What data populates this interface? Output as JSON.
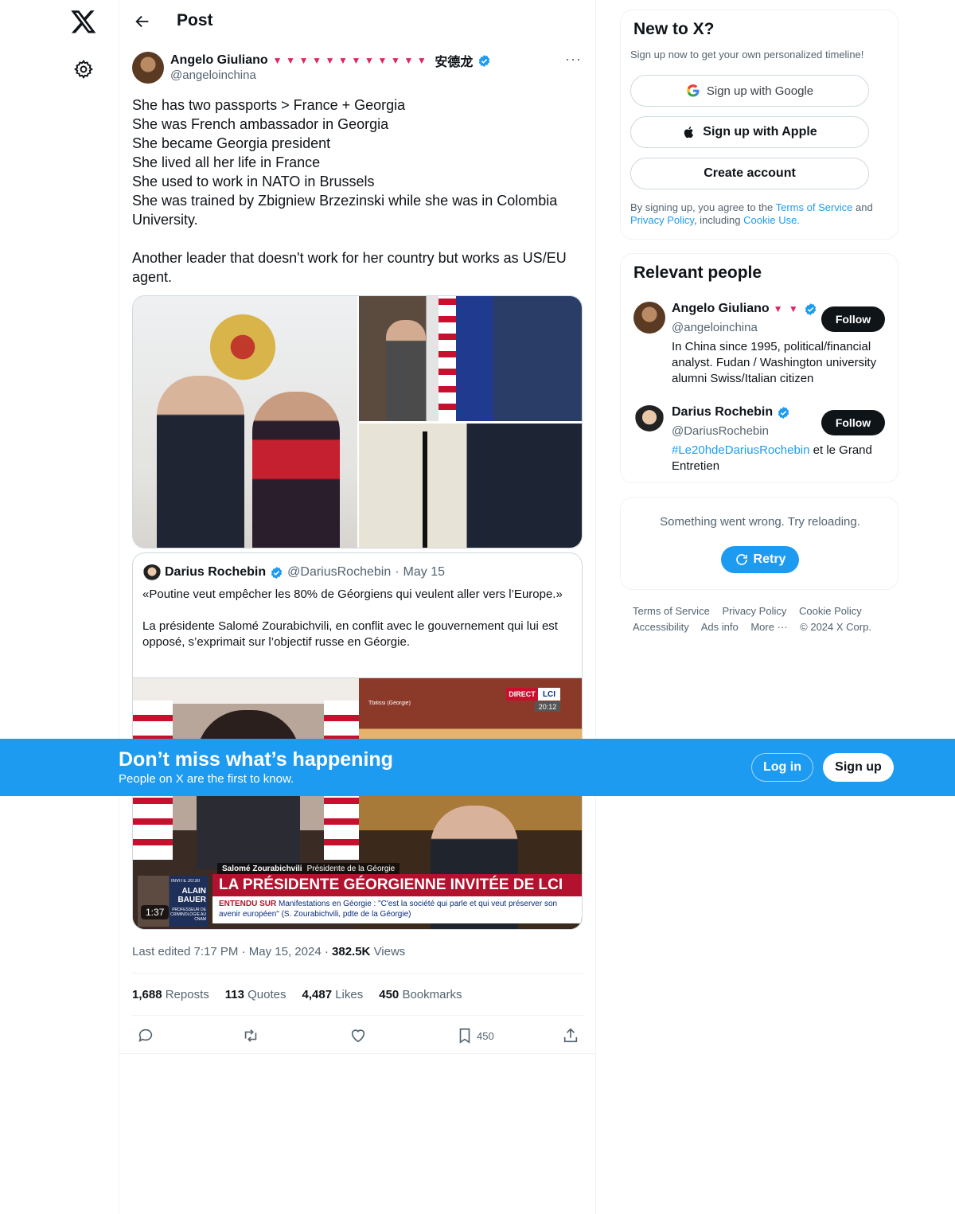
{
  "header": {
    "title": "Post"
  },
  "post": {
    "author_name": "Angelo Giuliano",
    "author_hearts": "▼▼▼▼▼▼▼▼▼▼▼▼",
    "author_suffix": "安德龙",
    "author_handle": "@angeloinchina",
    "more": "···",
    "text": "She has two passports > France + Georgia\nShe was French ambassador in Georgia\nShe became Georgia president\nShe lived all her life in France\nShe used to work in NATO in Brussels\nShe was trained by Zbigniew Brzezinski while she was in Colombia University.\n\nAnother leader that doesn't work for her country but works as US/EU agent.",
    "meta_edited": "Last edited 7:17 PM",
    "meta_date": "May 15, 2024",
    "meta_views_count": "382.5K",
    "meta_views_label": "Views",
    "stats": {
      "reposts_count": "1,688",
      "reposts_label": "Reposts",
      "quotes_count": "113",
      "quotes_label": "Quotes",
      "likes_count": "4,487",
      "likes_label": "Likes",
      "bookmarks_count": "450",
      "bookmarks_label": "Bookmarks"
    },
    "bookmark_action_count": "450"
  },
  "quote": {
    "name": "Darius Rochebin",
    "handle": "@DariusRochebin",
    "date": "May 15",
    "text": "«Poutine veut empêcher les 80% de Géorgiens qui veulent aller vers l’Europe.»\n\nLa présidente Salomé Zourabichvili, en conflit avec le gouvernement qui lui est opposé, s’exprimait sur l’objectif russe en Géorgie.",
    "video_duration": "1:37",
    "lci_direct": "DIRECT",
    "lci_logo": "LCI",
    "lci_clock": "20:12",
    "lci_location": "Tbilissi (Géorgie)",
    "lci_caption_name": "Salomé Zourabichvili",
    "lci_caption_role": "Présidente de la Géorgie",
    "lci_headline": "LA PRÉSIDENTE GÉORGIENNE INVITÉE DE LCI",
    "lci_ticker_prefix": "ENTENDU SUR",
    "lci_ticker": "Manifestations en Géorgie : \"C'est la société qui parle et qui veut préserver son avenir européen\" (S. Zourabichvili, pdte de la Géorgie)",
    "lci_guest_tag": "INVITÉ",
    "lci_guest_time": "20:30",
    "lci_guest_name": "ALAIN BAUER",
    "lci_guest_role": "PROFESSEUR DE CRIMINOLOGIE AU CNAM"
  },
  "banner": {
    "title": "Don’t miss what’s happening",
    "subtitle": "People on X are the first to know.",
    "login": "Log in",
    "signup": "Sign up"
  },
  "new_to_x": {
    "title": "New to X?",
    "subtitle": "Sign up now to get your own personalized timeline!",
    "google": "Sign up with Google",
    "apple": "Sign up with Apple",
    "create": "Create account",
    "terms_prefix": "By signing up, you agree to the ",
    "terms_link": "Terms of Service",
    "terms_and": " and ",
    "privacy_link": "Privacy Policy",
    "including": ", including ",
    "cookie_link": "Cookie Use."
  },
  "relevant": {
    "title": "Relevant people",
    "people": [
      {
        "name": "Angelo Giuliano",
        "hearts": "▼ ▼",
        "handle": "@angeloinchina",
        "bio": "In China since 1995, political/financial analyst. Fudan / Washington university alumni Swiss/Italian citizen",
        "follow": "Follow"
      },
      {
        "name": "Darius Rochebin",
        "handle": "@DariusRochebin",
        "bio_link": "#Le20hdeDariusRochebin",
        "bio_rest": " et le Grand Entretien",
        "follow": "Follow"
      }
    ]
  },
  "error_card": {
    "message": "Something went wrong. Try reloading.",
    "retry": "Retry"
  },
  "footer": {
    "links": [
      "Terms of Service",
      "Privacy Policy",
      "Cookie Policy",
      "Accessibility",
      "Ads info",
      "More ···"
    ],
    "copyright": "© 2024 X Corp."
  },
  "colors": {
    "accent": "#1d9bf0",
    "text": "#0f1419",
    "muted": "#536471",
    "border": "#eff3f4"
  }
}
